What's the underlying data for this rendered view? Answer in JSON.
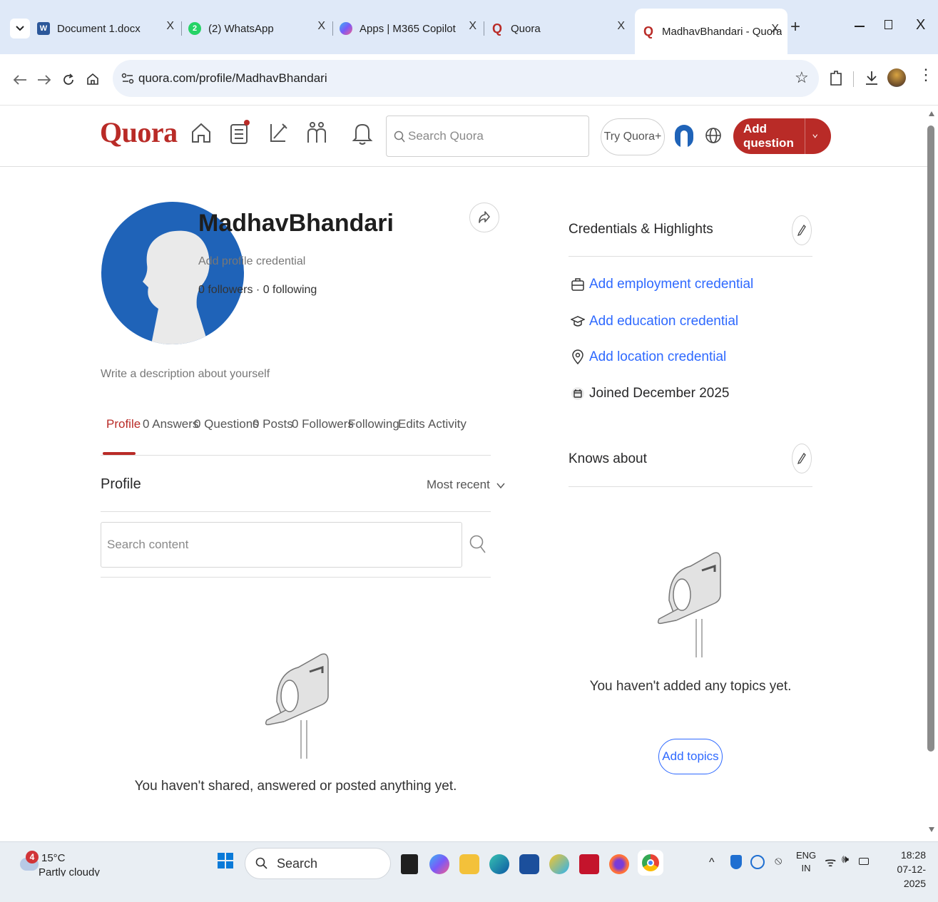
{
  "browser": {
    "tabs": [
      {
        "title": "Document 1.docx",
        "favicon": "word-icon",
        "color": "#2b579a"
      },
      {
        "title": "(2) WhatsApp",
        "favicon": "whatsapp-icon",
        "color": "#25d366",
        "badge": "2"
      },
      {
        "title": "Apps | M365 Copilot",
        "favicon": "copilot-icon",
        "color": "#7a5af8"
      },
      {
        "title": "Quora",
        "favicon": "quora-icon",
        "color": "#b92b27"
      },
      {
        "title": "MadhavBhandari - Quora",
        "favicon": "quora-icon",
        "color": "#b92b27",
        "active": true
      }
    ],
    "url": "quora.com/profile/MadhavBhandari"
  },
  "header": {
    "logo": "Quora",
    "search_placeholder": "Search Quora",
    "try_plus": "Try Quora+",
    "add_question": "Add question"
  },
  "profile": {
    "name": "MadhavBhandari",
    "credential_prompt": "Add profile credential",
    "follow_stats": "0 followers · 0 following",
    "description_prompt": "Write a description about yourself",
    "tabs": [
      "Profile",
      "0 Answers",
      "0 Questions",
      "0 Posts",
      "0 Followers",
      "Following",
      "Edits",
      "Activity"
    ],
    "section_title": "Profile",
    "sort": "Most recent",
    "content_search_placeholder": "Search content",
    "empty_message": "You haven't shared, answered or posted anything yet."
  },
  "sidebar": {
    "credentials_title": "Credentials & Highlights",
    "credentials": [
      {
        "label": "Add employment credential",
        "icon": "briefcase-icon"
      },
      {
        "label": "Add education credential",
        "icon": "graduation-cap-icon"
      },
      {
        "label": "Add location credential",
        "icon": "location-pin-icon"
      }
    ],
    "joined": "Joined December 2025",
    "knows_title": "Knows about",
    "knows_empty": "You haven't added any topics yet.",
    "add_topics": "Add topics"
  },
  "taskbar": {
    "weather_temp": "15°C",
    "weather_desc": "Partly cloudy",
    "weather_badge": "4",
    "search": "Search",
    "lang_top": "ENG",
    "lang_bottom": "IN",
    "time": "18:28",
    "date": "07-12-2025"
  },
  "colors": {
    "quora_red": "#b92b27",
    "link_blue": "#2e69ff",
    "avatar_blue": "#1f63b8"
  }
}
